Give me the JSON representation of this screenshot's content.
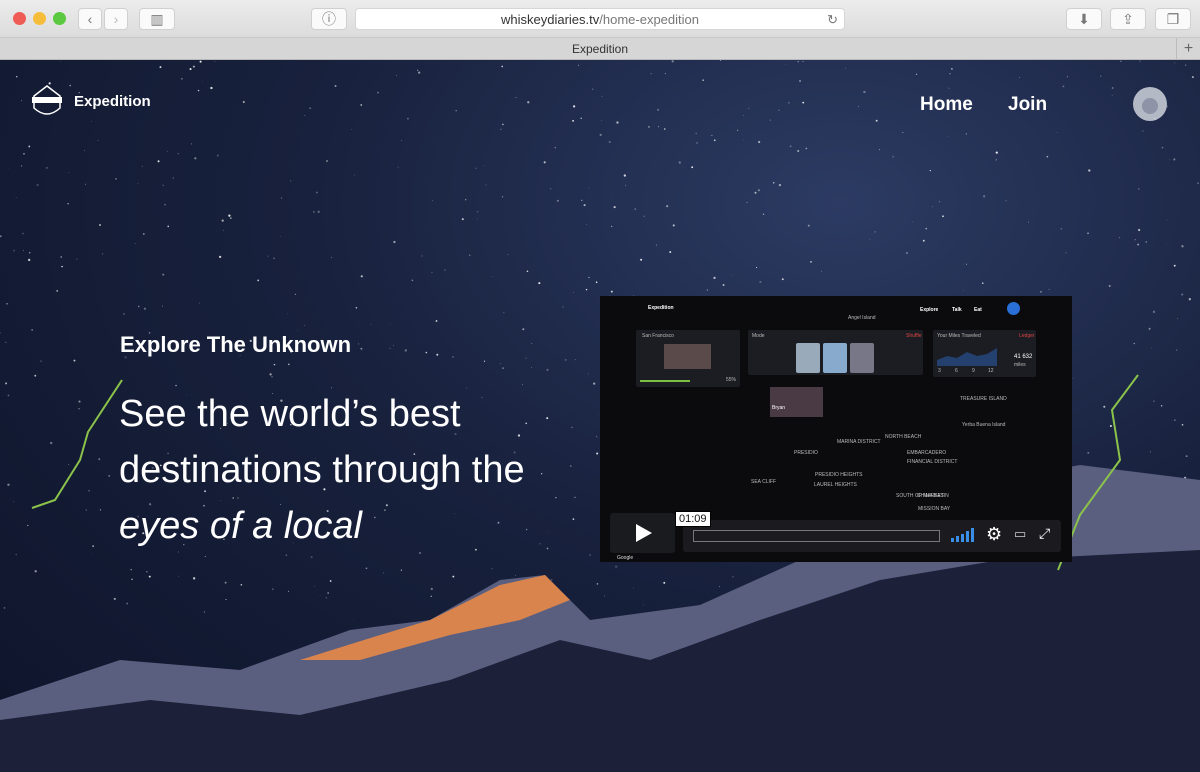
{
  "browser": {
    "url_domain": "whiskeydiaries.tv",
    "url_path": "/home-expedition",
    "tab_title": "Expedition"
  },
  "site": {
    "brand": "Expedition",
    "nav": [
      "Home",
      "Join"
    ]
  },
  "hero": {
    "kicker": "Explore The Unknown",
    "line1_plain": "See the world’s ",
    "line1_bold": "best",
    "line2_bold": "destinations",
    "line2_plain": " through the",
    "line3_italic": "eyes of a local"
  },
  "video": {
    "brand": "Expedition",
    "nav": [
      "Explore",
      "Talk",
      "Eat"
    ],
    "city": "San Francisco",
    "progress_pct": "55%",
    "mode": "Mode",
    "shuffle": "Shuffle",
    "miles_title": "Your Miles Traveled",
    "ledger": "Ledger",
    "miles_value": "41 632",
    "miles_unit": "miles",
    "chart_ticks": [
      "3",
      "6",
      "9",
      "12"
    ],
    "map_labels": [
      "MARINA DISTRICT",
      "PRESIDIO",
      "NORTH BEACH",
      "EMBARCADERO",
      "FINANCIAL DISTRICT",
      "PRESIDIO HEIGHTS",
      "LAUREL HEIGHTS",
      "SEA CLIFF",
      "SOUTH OF MARKET",
      "CHINA BASIN",
      "MISSION BAY",
      "TREASURE ISLAND",
      "Yerba Buena Island",
      "Angel Island"
    ],
    "time": "01:09",
    "google": "Google",
    "pin_label": "Bryan"
  }
}
